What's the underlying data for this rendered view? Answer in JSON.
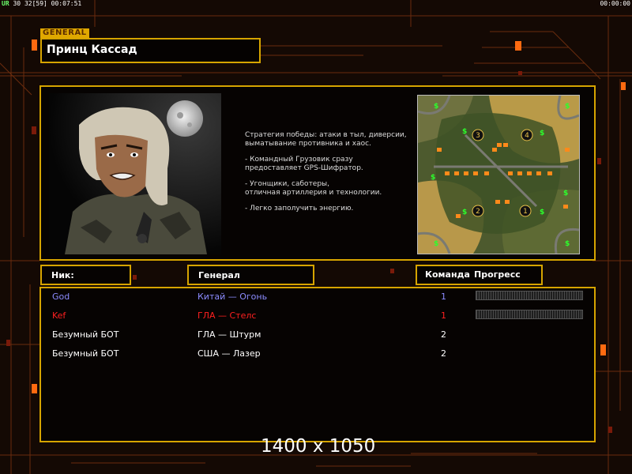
{
  "hud": {
    "left_a": "UR",
    "left_b": "30",
    "left_c": "32[59]",
    "left_time": "00:07:51",
    "right_time": "00:00:00"
  },
  "header": {
    "tag": "GENERAL",
    "title": "Принц Кассад"
  },
  "info": {
    "description": [
      "Стратегия победы: атаки в тыл, диверсии,\n выматывание противника и хаос.",
      "- Командный Грузовик сразу\nпредоставляет GPS-Шифратор.",
      "- Угонщики, саботеры,\nотличная артиллерия и технологии.",
      "- Легко заполучить энергию."
    ],
    "map_labels": [
      "3",
      "4",
      "2",
      "1"
    ],
    "map_icons": {
      "money": "$",
      "oil": "oil-derrick-icon"
    }
  },
  "columns": {
    "nick": "Ник:",
    "general": "Генерал",
    "team": "Команда",
    "progress": "Прогресс"
  },
  "players": [
    {
      "nick": "God",
      "general": "Китай — Огонь",
      "team": "1",
      "color": "#8c8cff",
      "progress": 0
    },
    {
      "nick": "Kef",
      "general": "ГЛА — Стелс",
      "team": "1",
      "color": "#ff2020",
      "progress": 0
    },
    {
      "nick": "Безумный БОТ",
      "general": "ГЛА — Штурм",
      "team": "2",
      "color": "#ffffff",
      "progress": null
    },
    {
      "nick": "Безумный БОТ",
      "general": "США — Лазер",
      "team": "2",
      "color": "#ffffff",
      "progress": null
    }
  ],
  "watermark": "1400 x 1050",
  "colors": {
    "frame": "#d6a400",
    "background": "#140904"
  }
}
